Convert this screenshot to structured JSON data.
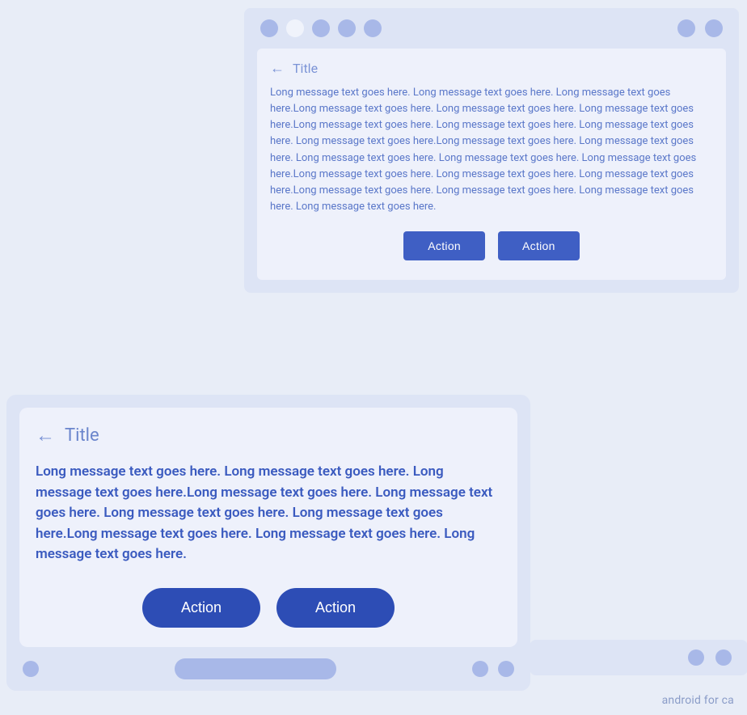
{
  "topCard": {
    "toolbar": {
      "dots": [
        "dot-sm",
        "dot-md-white",
        "dot-md",
        "dot-md",
        "dot-md"
      ],
      "rightDots": [
        "dot-md",
        "dot-md"
      ]
    },
    "header": {
      "backLabel": "←",
      "title": "Title"
    },
    "message": "Long message text goes here. Long message text goes here. Long message text goes here.Long message text goes here. Long message text goes here. Long message text goes here.Long message text goes here. Long message text goes here. Long message text goes here. Long message text goes here.Long message text goes here. Long message text goes here. Long message text goes here. Long message text goes here. Long message text goes here.Long message text goes here. Long message text goes here. Long message text goes here.Long message text goes here. Long message text goes here. Long message text goes here. Long message text goes here.",
    "action1": "Action",
    "action2": "Action"
  },
  "bottomCard": {
    "header": {
      "backLabel": "←",
      "title": "Title"
    },
    "message": "Long message text goes here. Long message text goes here. Long message text goes here.Long message text goes here. Long message text goes here. Long message text goes here. Long message text goes here.Long message text goes here. Long message text goes here. Long message text goes here.",
    "action1": "Action",
    "action2": "Action",
    "nav": {
      "dotLeft": true,
      "pill": true,
      "dotsRight": [
        "dot1",
        "dot2"
      ]
    }
  },
  "watermark": "android for ca"
}
